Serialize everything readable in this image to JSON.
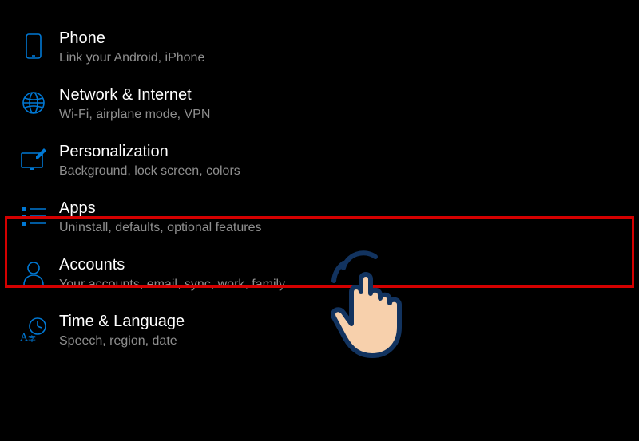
{
  "settings": {
    "items": [
      {
        "title": "Phone",
        "desc": "Link your Android, iPhone"
      },
      {
        "title": "Network & Internet",
        "desc": "Wi-Fi, airplane mode, VPN"
      },
      {
        "title": "Personalization",
        "desc": "Background, lock screen, colors"
      },
      {
        "title": "Apps",
        "desc": "Uninstall, defaults, optional features"
      },
      {
        "title": "Accounts",
        "desc": "Your accounts, email, sync, work, family"
      },
      {
        "title": "Time & Language",
        "desc": "Speech, region, date"
      }
    ]
  },
  "annotation": {
    "highlighted_item": "apps",
    "cursor": "tap-hand"
  }
}
